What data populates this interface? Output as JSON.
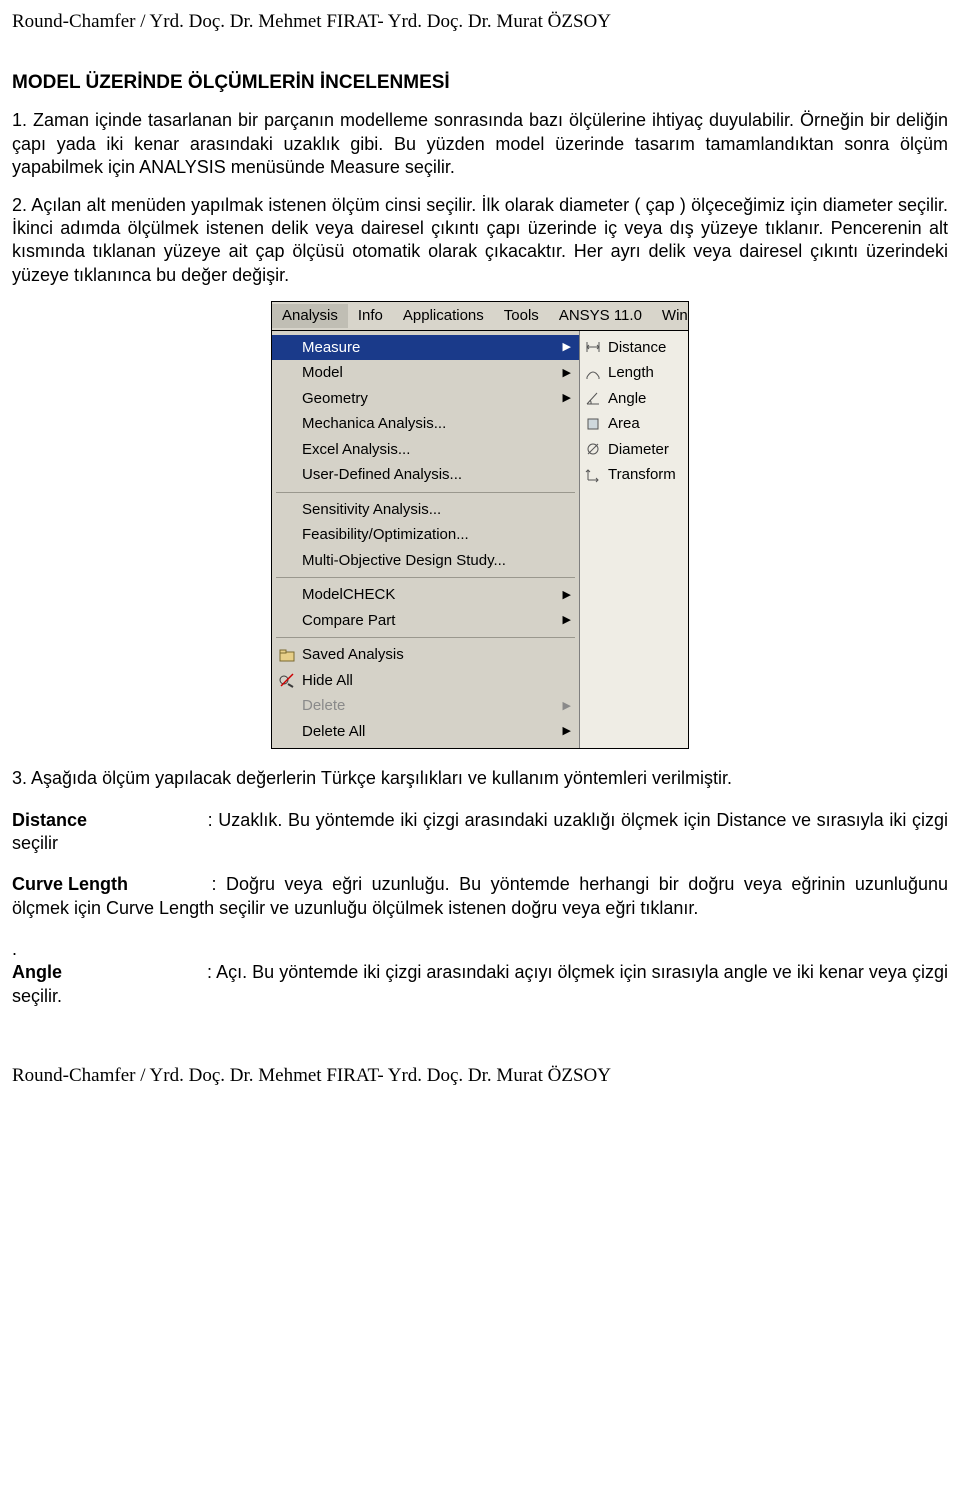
{
  "header": "Round-Chamfer / Yrd. Doç. Dr. Mehmet FIRAT- Yrd. Doç. Dr. Murat ÖZSOY",
  "footer": "Round-Chamfer / Yrd. Doç. Dr. Mehmet FIRAT- Yrd. Doç. Dr. Murat ÖZSOY",
  "title": "MODEL ÜZERİNDE ÖLÇÜMLERİN İNCELENMESİ",
  "para1": "1. Zaman içinde tasarlanan bir parçanın modelleme sonrasında bazı ölçülerine ihtiyaç duyulabilir. Örneğin bir deliğin çapı yada iki kenar arasındaki uzaklık gibi. Bu yüzden model üzerinde tasarım tamamlandıktan sonra ölçüm yapabilmek için ANALYSIS menüsünde Measure seçilir.",
  "para2": "2. Açılan alt menüden yapılmak istenen ölçüm cinsi seçilir. İlk olarak diameter ( çap ) ölçeceğimiz için diameter seçilir. İkinci adımda ölçülmek istenen delik veya dairesel çıkıntı çapı üzerinde iç veya dış yüzeye tıklanır. Pencerenin alt kısmında tıklanan yüzeye ait çap ölçüsü otomatik olarak çıkacaktır. Her ayrı delik veya dairesel çıkıntı üzerindeki yüzeye tıklanınca bu değer değişir.",
  "para3": "3. Aşağıda ölçüm yapılacak değerlerin Türkçe karşılıkları ve kullanım yöntemleri verilmiştir.",
  "defs": {
    "distance": {
      "term": "Distance",
      "text": ": Uzaklık. Bu yöntemde iki çizgi arasındaki uzaklığı ölçmek için Distance ve sırasıyla iki çizgi seçilir"
    },
    "curve": {
      "term": "Curve Length",
      "text": ": Doğru veya eğri uzunluğu. Bu yöntemde herhangi bir doğru veya eğrinin uzunluğunu ölçmek için Curve Length seçilir ve uzunluğu ölçülmek istenen doğru veya eğri tıklanır."
    },
    "angle": {
      "term": "Angle",
      "text": ": Açı. Bu yöntemde iki çizgi arasındaki açıyı ölçmek için sırasıyla angle ve iki kenar veya çizgi seçilir."
    },
    "dot": "."
  },
  "menu": {
    "tabs": {
      "analysis": "Analysis",
      "info": "Info",
      "applications": "Applications",
      "tools": "Tools",
      "ansys": "ANSYS 11.0",
      "win": "Win"
    },
    "left": {
      "measure": "Measure",
      "model": "Model",
      "geometry": "Geometry",
      "mechanica": "Mechanica Analysis...",
      "excel": "Excel Analysis...",
      "userdef": "User-Defined Analysis...",
      "sensitivity": "Sensitivity Analysis...",
      "feasibility": "Feasibility/Optimization...",
      "multi": "Multi-Objective Design Study...",
      "modelcheck": "ModelCHECK",
      "compare": "Compare Part",
      "saved": "Saved Analysis",
      "hide": "Hide All",
      "delete": "Delete",
      "deleteall": "Delete All"
    },
    "right": {
      "distance": "Distance",
      "length": "Length",
      "angle": "Angle",
      "area": "Area",
      "diameter": "Diameter",
      "transform": "Transform"
    }
  }
}
